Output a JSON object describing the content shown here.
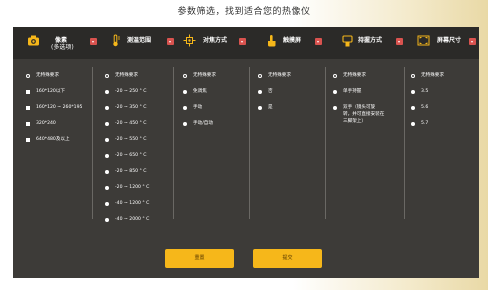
{
  "page": {
    "title": "参数筛选，找到适合您的热像仪"
  },
  "tabs": [
    {
      "label": "像素",
      "sublabel": "(多选项)",
      "icon": "camera-icon"
    },
    {
      "label": "测温范围",
      "sublabel": "",
      "icon": "thermometer-icon"
    },
    {
      "label": "对焦方式",
      "sublabel": "",
      "icon": "focus-target-icon"
    },
    {
      "label": "触摸屏",
      "sublabel": "",
      "icon": "touch-hand-icon"
    },
    {
      "label": "持握方式",
      "sublabel": "",
      "icon": "handheld-icon"
    },
    {
      "label": "屏幕尺寸",
      "sublabel": "",
      "icon": "screen-size-icon"
    }
  ],
  "columns": {
    "pixel": [
      "无特殊要求",
      "160*120以下",
      "160*120 ~ 260*195",
      "320*240",
      "640*480及以上"
    ],
    "temp_range": [
      "无特殊要求",
      "-20 ~ 250 ° C",
      "-20 ~ 350 ° C",
      "-20 ~ 450 ° C",
      "-20 ~ 550 ° C",
      "-20 ~ 650 ° C",
      "-20 ~ 850 ° C",
      "-20 ~ 1200 ° C",
      "-40 ~ 1200 ° C",
      "-40 ~ 2000 ° C"
    ],
    "focus": [
      "无特殊要求",
      "免调焦",
      "手动",
      "手动/自动"
    ],
    "touch": [
      "无特殊要求",
      "否",
      "是"
    ],
    "grip": [
      "无特殊要求",
      "单手持握",
      "双手（镜头可旋",
      "转，并可直接安装在",
      "三脚架上）"
    ],
    "screen": [
      "无特殊要求",
      "3.5",
      "5.6",
      "5.7"
    ]
  },
  "buttons": {
    "reset": "重置",
    "submit": "提交"
  },
  "colors": {
    "accent": "#f6b71a",
    "panel": "#3d3b38",
    "tabbar": "#2b2a28",
    "badge": "#d9534f"
  }
}
